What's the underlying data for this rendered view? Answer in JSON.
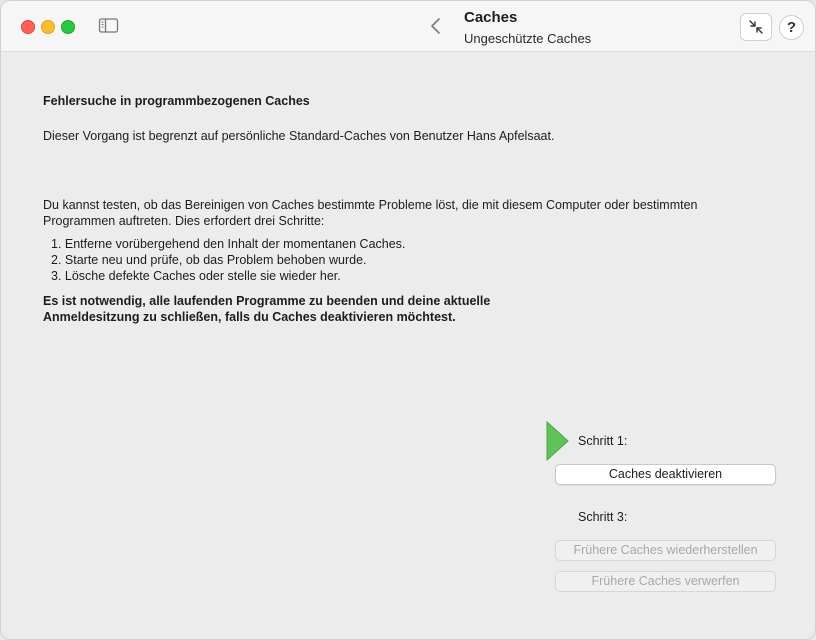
{
  "window": {
    "title": "Caches",
    "subtitle": "Ungeschützte Caches",
    "help_label": "?"
  },
  "content": {
    "heading": "Fehlersuche in programmbezogenen Caches",
    "scope": "Dieser Vorgang ist begrenzt auf persönliche Standard-Caches von Benutzer Hans Apfelsaat.",
    "intro": "Du kannst testen, ob das Bereinigen von Caches bestimmte Probleme löst, die mit diesem Computer oder bestimmten Programmen auftreten. Dies erfordert drei Schritte:",
    "steps": [
      "1. Entferne vorübergehend den Inhalt der momentanen Caches.",
      "2. Starte neu und prüfe, ob das Problem behoben wurde.",
      "3. Lösche defekte Caches oder stelle sie wieder her."
    ],
    "warning": "Es ist notwendig, alle laufenden Programme zu beenden und deine aktuelle Anmeldesitzung zu schließen, falls du Caches deaktivieren möchtest."
  },
  "actions": {
    "step1_label": "Schritt 1:",
    "deactivate_button": "Caches deaktivieren",
    "step3_label": "Schritt 3:",
    "restore_button": "Frühere Caches wiederherstellen",
    "discard_button": "Frühere Caches verwerfen"
  },
  "colors": {
    "step_arrow": "#5fc25a",
    "close": "#ff5f57",
    "minimize": "#febc2e",
    "maximize": "#28c840"
  },
  "icons": [
    "sidebar-toggle-icon",
    "chevron-left-icon",
    "collapse-arrows-icon",
    "question-icon",
    "play-arrow-icon"
  ]
}
